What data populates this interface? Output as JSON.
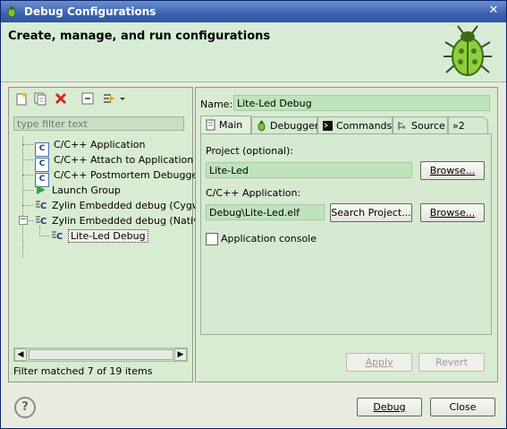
{
  "window": {
    "title": "Debug Configurations",
    "close_glyph": "✕"
  },
  "header": {
    "title": "Create, manage, and run configurations"
  },
  "left": {
    "filter_placeholder": "type filter text",
    "tree": [
      {
        "label": "C/C++ Application",
        "icon": "c-app-icon"
      },
      {
        "label": "C/C++ Attach to Application",
        "icon": "c-app-icon"
      },
      {
        "label": "C/C++ Postmortem Debugger",
        "icon": "c-app-icon"
      },
      {
        "label": "Launch Group",
        "icon": "launch-group-icon"
      },
      {
        "label": "Zylin Embedded debug (Cygwin)",
        "icon": "zylin-icon"
      },
      {
        "label": "Zylin Embedded debug (Native)",
        "icon": "zylin-icon"
      },
      {
        "label": "Lite-Led Debug",
        "icon": "zylin-icon"
      }
    ],
    "expander_glyph": "−",
    "status": "Filter matched 7 of 19 items"
  },
  "right": {
    "name_label": "Name:",
    "name_value": "Lite-Led Debug",
    "tabs": [
      {
        "label": "Main",
        "icon": "main-tab-icon"
      },
      {
        "label": "Debugger",
        "icon": "bug-icon"
      },
      {
        "label": "Commands",
        "icon": "terminal-icon"
      },
      {
        "label": "Source",
        "icon": "source-icon"
      },
      {
        "label": "»2",
        "icon": "overflow-icon"
      }
    ],
    "project_label": "Project (optional):",
    "project_value": "Lite-Led",
    "browse_label": "Browse...",
    "app_label": "C/C++ Application:",
    "app_value": "Debug\\Lite-Led.elf",
    "search_project_label": "Search Project...",
    "browse2_label": "Browse...",
    "console_label": "Application console",
    "console_checked": false,
    "apply_label": "Apply",
    "revert_label": "Revert"
  },
  "footer": {
    "help_glyph": "?",
    "debug_label": "Debug",
    "close_label": "Close"
  },
  "colors": {
    "accent": "#3b62b0",
    "panel_green": "#d8ecd2",
    "header_green": "#d6ecd5"
  }
}
